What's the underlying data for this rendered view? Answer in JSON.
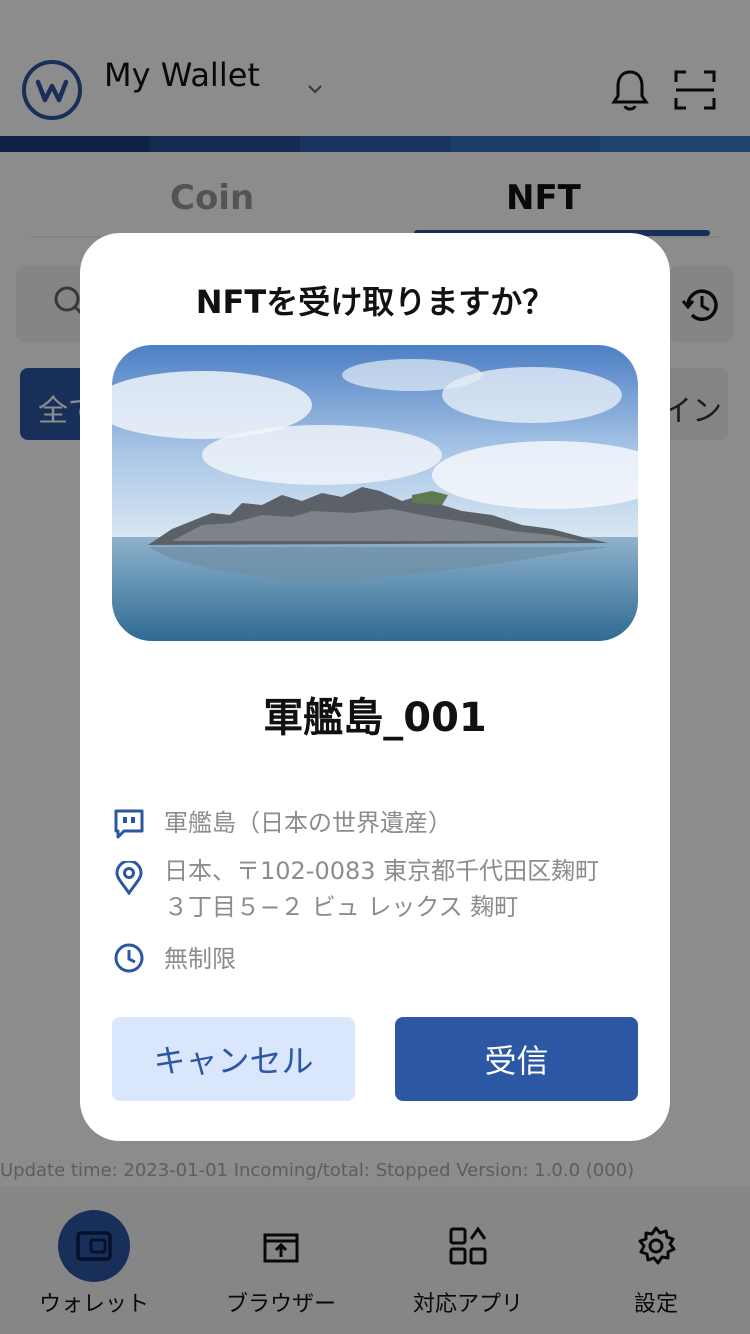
{
  "header": {
    "wallet_name": "My Wallet",
    "brand_color": "#2c57a2",
    "icons": [
      "wallet-logo-icon",
      "chevron-down-icon",
      "bell-icon",
      "scan-icon"
    ]
  },
  "tabs": [
    {
      "label": "Coin",
      "active": false
    },
    {
      "label": "NFT",
      "active": true
    }
  ],
  "filters": {
    "all_chip": "全て",
    "right_chip": "イン"
  },
  "footer_text": "Update time: 2023-01-01 Incoming/total: Stopped Version: 1.0.0 (000)",
  "bottom_nav": [
    {
      "label": "ウォレット",
      "icon": "wallet-icon",
      "active": true
    },
    {
      "label": "ブラウザー",
      "icon": "browser-icon",
      "active": false
    },
    {
      "label": "対応アプリ",
      "icon": "apps-icon",
      "active": false
    },
    {
      "label": "設定",
      "icon": "gear-icon",
      "active": false
    }
  ],
  "modal": {
    "title": "NFTを受け取りますか？",
    "nft_name": "軍艦島_001",
    "description": "軍艦島（日本の世界遺産）",
    "address_line1": "日本、〒102-0083 東京都千代田区麹町",
    "address_line2": "３丁目５−２ ビュ レックス 麹町",
    "validity": "無制限",
    "cancel_label": "キャンセル",
    "receive_label": "受信"
  }
}
